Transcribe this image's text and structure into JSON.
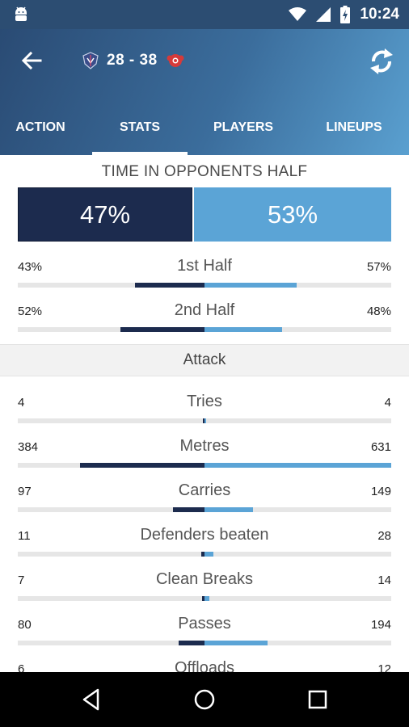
{
  "status_bar": {
    "time": "10:24"
  },
  "header": {
    "score": "28 - 38",
    "home_team_icon": "team-crest-icon",
    "away_team_icon": "team-crest-icon"
  },
  "tabs": [
    {
      "label": "ACTION",
      "active": false
    },
    {
      "label": "STATS",
      "active": true
    },
    {
      "label": "PLAYERS",
      "active": false
    },
    {
      "label": "LINEUPS",
      "active": false
    }
  ],
  "time_in_opponents_half": {
    "title": "TIME IN OPPONENTS HALF",
    "home_pct": "47%",
    "away_pct": "53%",
    "home_value": 47,
    "away_value": 53
  },
  "half_stats": [
    {
      "label": "1st Half",
      "home": "43%",
      "away": "57%",
      "home_value": 43,
      "away_value": 57
    },
    {
      "label": "2nd Half",
      "home": "52%",
      "away": "48%",
      "home_value": 52,
      "away_value": 48
    }
  ],
  "attack": {
    "title": "Attack",
    "stats": [
      {
        "label": "Tries",
        "home": "4",
        "away": "4",
        "home_value": 4,
        "away_value": 4
      },
      {
        "label": "Metres",
        "home": "384",
        "away": "631",
        "home_value": 384,
        "away_value": 631
      },
      {
        "label": "Carries",
        "home": "97",
        "away": "149",
        "home_value": 97,
        "away_value": 149
      },
      {
        "label": "Defenders beaten",
        "home": "11",
        "away": "28",
        "home_value": 11,
        "away_value": 28
      },
      {
        "label": "Clean Breaks",
        "home": "7",
        "away": "14",
        "home_value": 7,
        "away_value": 14
      },
      {
        "label": "Passes",
        "home": "80",
        "away": "194",
        "home_value": 80,
        "away_value": 194
      },
      {
        "label": "Offloads",
        "home": "6",
        "away": "12",
        "home_value": 6,
        "away_value": 12
      }
    ]
  },
  "colors": {
    "home": "#1c2b4e",
    "away": "#5ba4d6",
    "header_start": "#2a4b74",
    "header_end": "#5aa0d0"
  }
}
